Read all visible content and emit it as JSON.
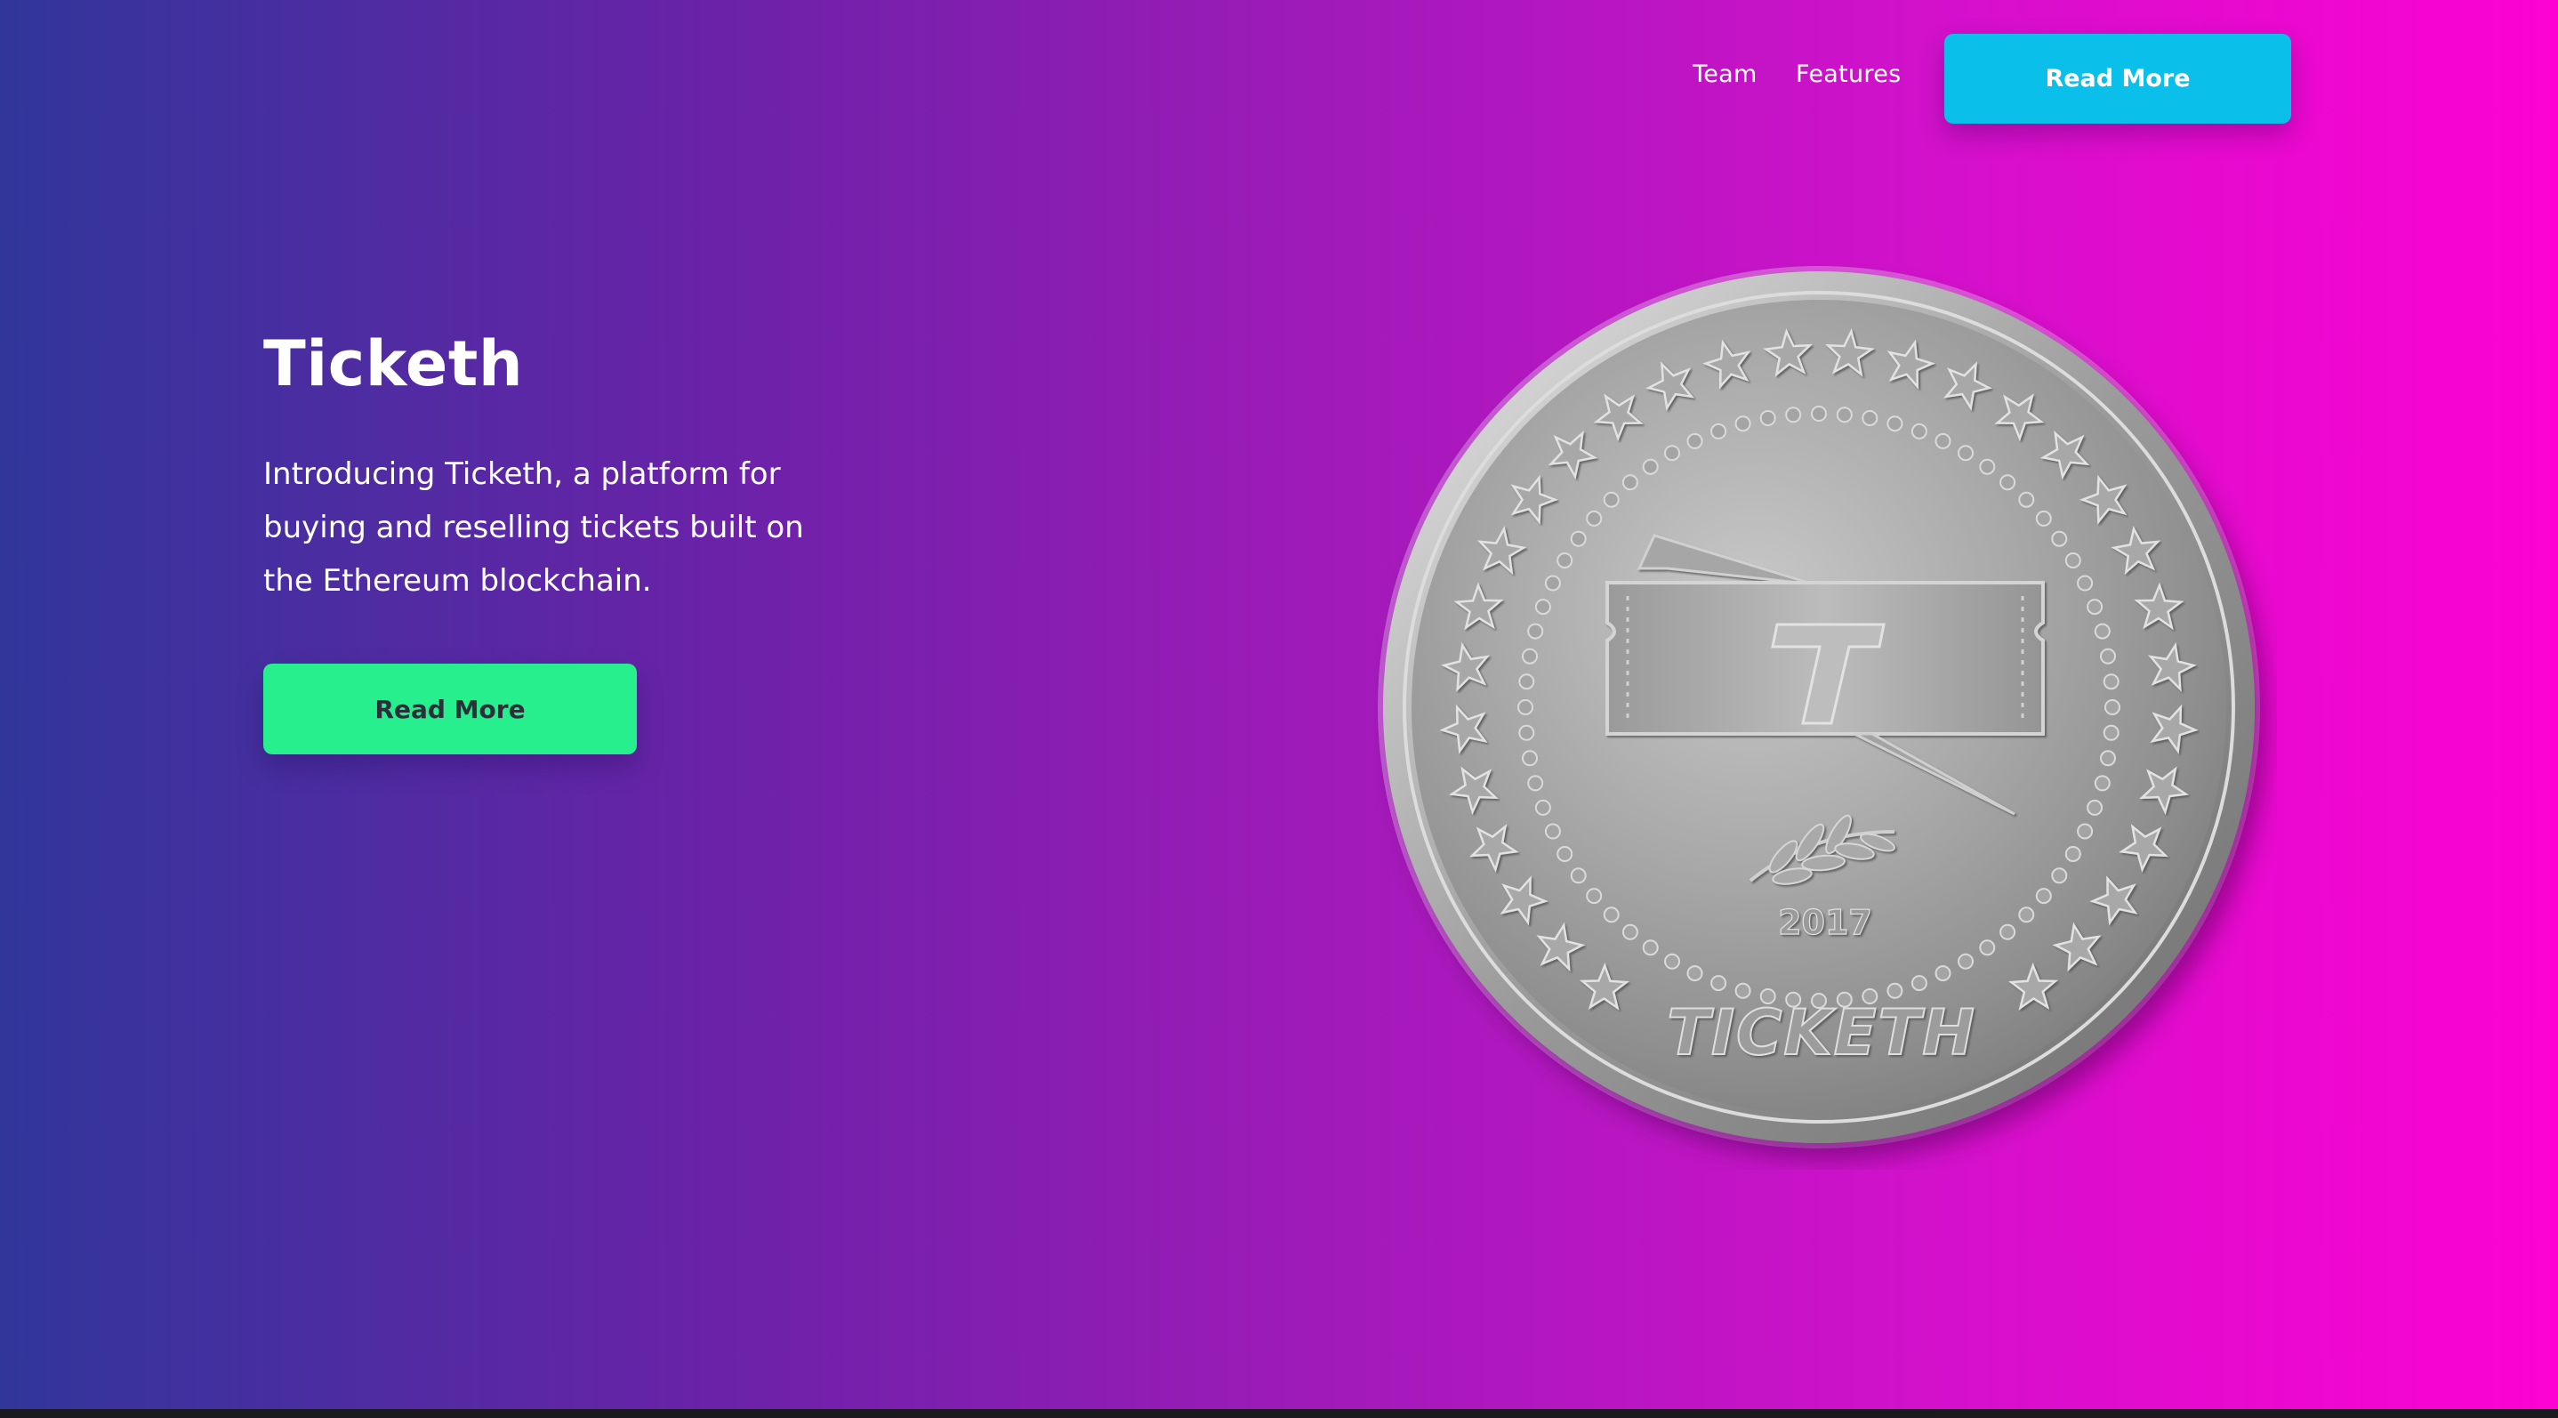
{
  "nav": {
    "links": [
      {
        "label": "Team"
      },
      {
        "label": "Features"
      }
    ],
    "cta_label": "Read More"
  },
  "hero": {
    "title": "Ticketh",
    "description": "Introducing Ticketh, a platform for buying and reselling tickets built on the Ethereum blockchain.",
    "cta_label": "Read More"
  },
  "coin": {
    "year": "2017",
    "brand": "TICKETH",
    "emblem_letter": "T"
  },
  "colors": {
    "gradient_start": "#31369b",
    "gradient_end": "#fd02d3",
    "nav_cta": "#0abfea",
    "hero_cta": "#27ef8d"
  }
}
